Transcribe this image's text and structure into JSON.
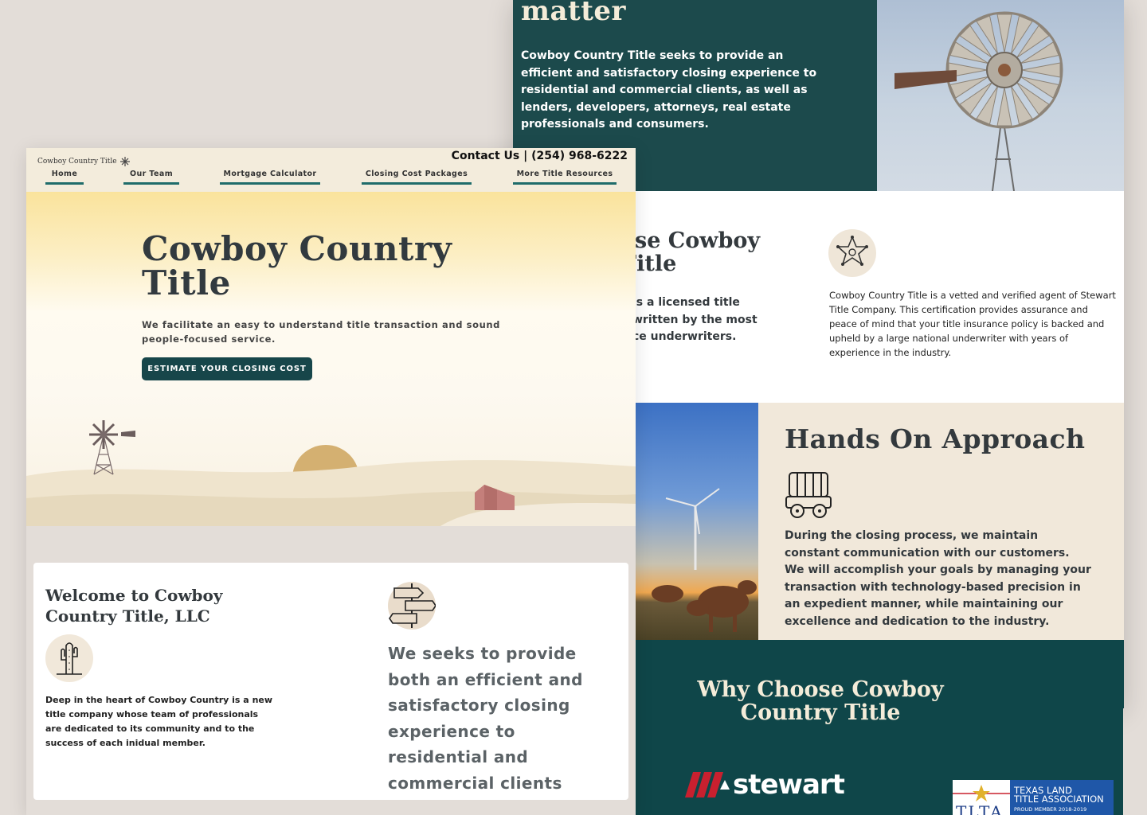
{
  "header": {
    "logo_text": "Cowboy Country Title",
    "contact": "Contact Us | (254) 968-6222",
    "nav": [
      "Home",
      "Our Team",
      "Mortgage Calculator",
      "Closing Cost Packages",
      "More Title Resources"
    ]
  },
  "hero": {
    "title": "Cowboy Country Title",
    "tagline": "We facilitate an easy to understand title transaction and sound people-focused service.",
    "cta": "ESTIMATE YOUR CLOSING COST"
  },
  "welcome": {
    "title": "Welcome to Cowboy Country Title, LLC",
    "description": "Deep in the heart of Cowboy Country is a new title company whose team of professionals are dedicated to its community and to the success of each inidual member.",
    "statement": "We seeks to provide both an efficient and satisfactory closing experience to residential and commercial clients"
  },
  "mission": {
    "heading": "matter",
    "text": "Cowboy Country Title seeks to provide an efficient and satisfactory closing experience to residential and commercial clients, as well as lenders, developers, attorneys, real estate professionals and consumers."
  },
  "why_partial": {
    "heading_line1": "ose Cowboy",
    "heading_line2": "Title",
    "text_line1": "is a licensed title",
    "text_line2": "written by the most",
    "text_line3": "ce underwriters.",
    "stewart_text": "Cowboy Country Title is a vetted and verified agent of Stewart Title Company. This certification provides assurance and peace of mind that your title insurance policy is backed and upheld by a large national underwriter with years of experience in the industry."
  },
  "hands_on": {
    "title": "Hands On Approach",
    "text": "During the closing process, we maintain constant communication with our customers. We will accomplish your goals by managing your transaction with technology-based precision in an expedient manner, while maintaining our excellence and dedication to the industry."
  },
  "why_choose": {
    "title": "Why Choose Cowboy Country Title",
    "stewart_logo": "stewart",
    "tlta_mark": "TLTA",
    "tlta_line1": "TEXAS LAND",
    "tlta_line2": "TITLE ASSOCIATION",
    "tlta_line3": "PROUD MEMBER 2018-2019"
  },
  "colors": {
    "teal_dark": "#0f4649",
    "teal": "#1c4a4c",
    "cream": "#f1e8da",
    "background": "#e3ddd8",
    "stewart_red": "#c8202f",
    "tlta_blue": "#1f57a8"
  },
  "icons": [
    "windmill-icon",
    "sun-icon",
    "barn-icon",
    "cactus-icon",
    "signpost-icon",
    "sheriff-star-icon",
    "wagon-icon",
    "stewart-logo-icon",
    "tlta-star-icon"
  ]
}
